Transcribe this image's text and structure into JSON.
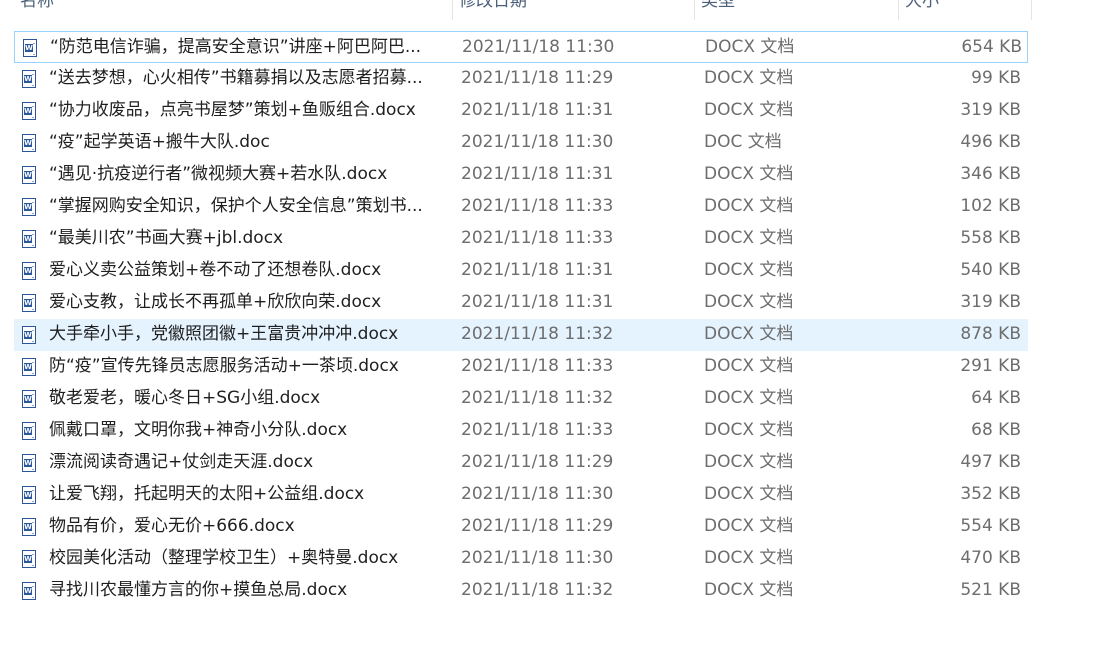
{
  "columns": {
    "name": "名称",
    "date": "修改日期",
    "type": "类型",
    "size": "大小"
  },
  "files": [
    {
      "name": "“防范电信诈骗，提高安全意识”讲座+阿巴阿巴...",
      "date": "2021/11/18 11:30",
      "type": "DOCX 文档",
      "size": "654 KB",
      "state": "focused"
    },
    {
      "name": "“送去梦想，心火相传”书籍募捐以及志愿者招募...",
      "date": "2021/11/18 11:29",
      "type": "DOCX 文档",
      "size": "99 KB",
      "state": ""
    },
    {
      "name": "“协力收废品，点亮书屋梦”策划+鱼贩组合.docx",
      "date": "2021/11/18 11:31",
      "type": "DOCX 文档",
      "size": "319 KB",
      "state": ""
    },
    {
      "name": "“疫”起学英语+搬牛大队.doc",
      "date": "2021/11/18 11:30",
      "type": "DOC 文档",
      "size": "496 KB",
      "state": ""
    },
    {
      "name": "“遇见·抗疫逆行者”微视频大赛+若水队.docx",
      "date": "2021/11/18 11:31",
      "type": "DOCX 文档",
      "size": "346 KB",
      "state": ""
    },
    {
      "name": "“掌握网购安全知识，保护个人安全信息”策划书...",
      "date": "2021/11/18 11:33",
      "type": "DOCX 文档",
      "size": "102 KB",
      "state": ""
    },
    {
      "name": "“最美川农”书画大赛+jbl.docx",
      "date": "2021/11/18 11:33",
      "type": "DOCX 文档",
      "size": "558 KB",
      "state": ""
    },
    {
      "name": "爱心义卖公益策划+卷不动了还想卷队.docx",
      "date": "2021/11/18 11:31",
      "type": "DOCX 文档",
      "size": "540 KB",
      "state": ""
    },
    {
      "name": "爱心支教，让成长不再孤单+欣欣向荣.docx",
      "date": "2021/11/18 11:31",
      "type": "DOCX 文档",
      "size": "319 KB",
      "state": ""
    },
    {
      "name": "大手牵小手，党徽照团徽+王富贵冲冲冲.docx",
      "date": "2021/11/18 11:32",
      "type": "DOCX 文档",
      "size": "878 KB",
      "state": "selected"
    },
    {
      "name": "防“疫”宣传先锋员志愿服务活动+一茶顷.docx",
      "date": "2021/11/18 11:33",
      "type": "DOCX 文档",
      "size": "291 KB",
      "state": ""
    },
    {
      "name": "敬老爱老，暖心冬日+SG小组.docx",
      "date": "2021/11/18 11:32",
      "type": "DOCX 文档",
      "size": "64 KB",
      "state": ""
    },
    {
      "name": "佩戴口罩，文明你我+神奇小分队.docx",
      "date": "2021/11/18 11:33",
      "type": "DOCX 文档",
      "size": "68 KB",
      "state": ""
    },
    {
      "name": "漂流阅读奇遇记+仗剑走天涯.docx",
      "date": "2021/11/18 11:29",
      "type": "DOCX 文档",
      "size": "497 KB",
      "state": ""
    },
    {
      "name": "让爱飞翔，托起明天的太阳+公益组.docx",
      "date": "2021/11/18 11:30",
      "type": "DOCX 文档",
      "size": "352 KB",
      "state": ""
    },
    {
      "name": "物品有价，爱心无价+666.docx",
      "date": "2021/11/18 11:29",
      "type": "DOCX 文档",
      "size": "554 KB",
      "state": ""
    },
    {
      "name": "校园美化活动（整理学校卫生）+奥特曼.docx",
      "date": "2021/11/18 11:30",
      "type": "DOCX 文档",
      "size": "470 KB",
      "state": ""
    },
    {
      "name": "寻找川农最懂方言的你+摸鱼总局.docx",
      "date": "2021/11/18 11:32",
      "type": "DOCX 文档",
      "size": "521 KB",
      "state": ""
    }
  ],
  "icon": "word-document-icon"
}
